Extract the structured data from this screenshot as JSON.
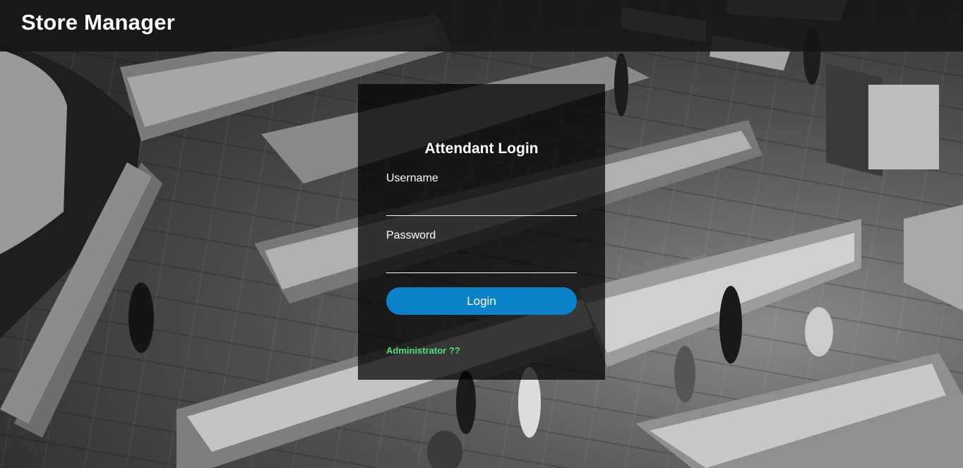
{
  "header": {
    "brand": "Store Manager"
  },
  "login": {
    "title": "Attendant Login",
    "username_label": "Username",
    "username_value": "",
    "password_label": "Password",
    "password_value": "",
    "button_label": "Login",
    "admin_link": "Administrator ??"
  },
  "colors": {
    "button": "#0a82c9",
    "admin_link": "#4ee07a",
    "header_bg": "#161616"
  },
  "background": {
    "description_icon": "supermarket-photo"
  }
}
